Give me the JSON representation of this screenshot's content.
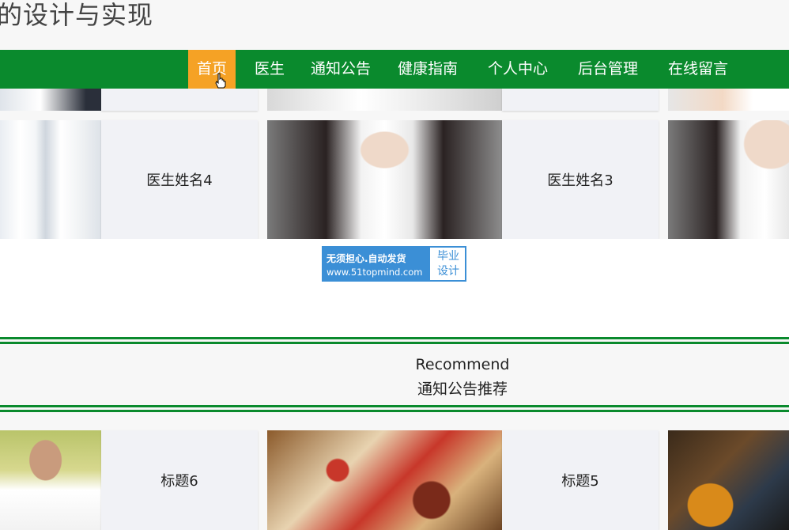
{
  "header": {
    "title": "的设计与实现"
  },
  "nav": {
    "items": [
      {
        "label": "首页",
        "active": true
      },
      {
        "label": "医生"
      },
      {
        "label": "通知公告"
      },
      {
        "label": "健康指南"
      },
      {
        "label": "个人中心"
      },
      {
        "label": "后台管理"
      },
      {
        "label": "在线留言"
      }
    ]
  },
  "doctors": {
    "cards": [
      {
        "name": "医生姓名4"
      },
      {
        "name": "医生姓名3"
      }
    ]
  },
  "ad": {
    "line1": "无须担心.自动发货",
    "line2": "www.51topmind.com",
    "right1": "毕业",
    "right2": "设计"
  },
  "recommend": {
    "title_en": "Recommend",
    "title_cn": "通知公告推荐"
  },
  "notices": {
    "cards": [
      {
        "title": "标题6"
      },
      {
        "title": "标题5"
      }
    ]
  },
  "colors": {
    "nav_bg": "#0a8a2d",
    "nav_active": "#f5a225",
    "ad_blue": "#3b8fd6"
  }
}
